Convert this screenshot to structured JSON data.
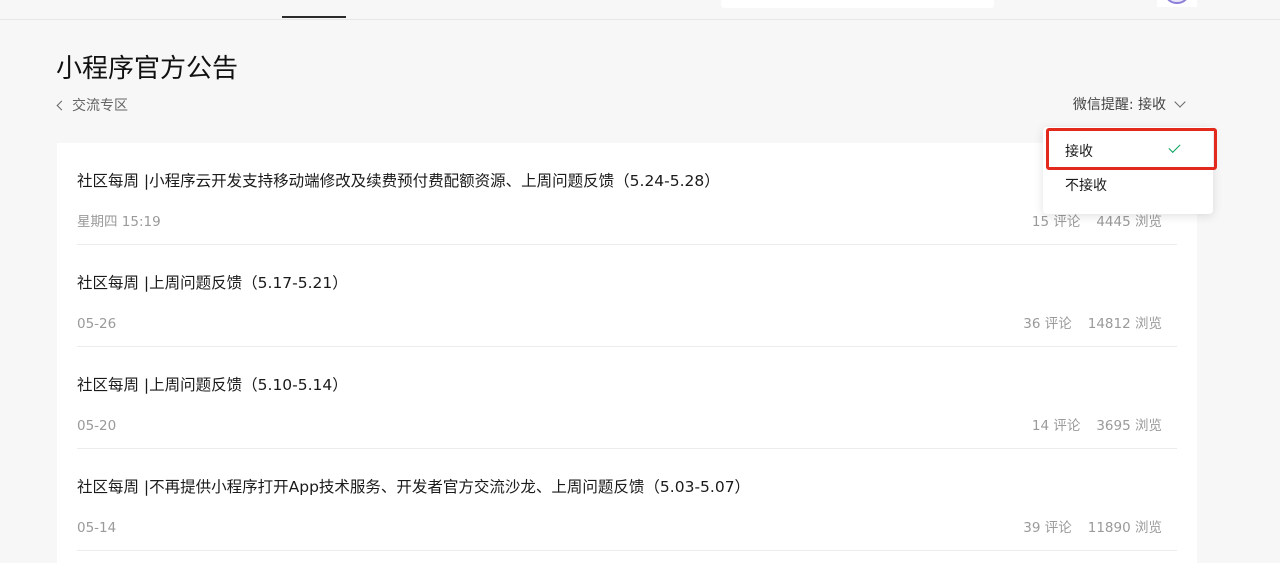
{
  "page": {
    "title": "小程序官方公告",
    "breadcrumb_label": "交流专区"
  },
  "notify": {
    "label": "微信提醒: 接收"
  },
  "dropdown": {
    "options": [
      {
        "label": "接收",
        "selected": true
      },
      {
        "label": "不接收",
        "selected": false
      }
    ]
  },
  "posts": [
    {
      "title": "社区每周 |小程序云开发支持移动端修改及续费预付费配额资源、上周问题反馈（5.24-5.28）",
      "date": "星期四 15:19",
      "comments": "15 评论",
      "views": "4445 浏览"
    },
    {
      "title": "社区每周 |上周问题反馈（5.17-5.21）",
      "date": "05-26",
      "comments": "36 评论",
      "views": "14812 浏览"
    },
    {
      "title": "社区每周 |上周问题反馈（5.10-5.14）",
      "date": "05-20",
      "comments": "14 评论",
      "views": "3695 浏览"
    },
    {
      "title": "社区每周 |不再提供小程序打开App技术服务、开发者官方交流沙龙、上周问题反馈（5.03-5.07）",
      "date": "05-14",
      "comments": "39 评论",
      "views": "11890 浏览"
    }
  ],
  "colors": {
    "highlight": "#e3281c",
    "check": "#07a05a",
    "background": "#f7f7f7"
  },
  "icons": {
    "back": "chevron-left-icon",
    "dropdown": "chevron-down-icon",
    "selected": "check-icon"
  }
}
